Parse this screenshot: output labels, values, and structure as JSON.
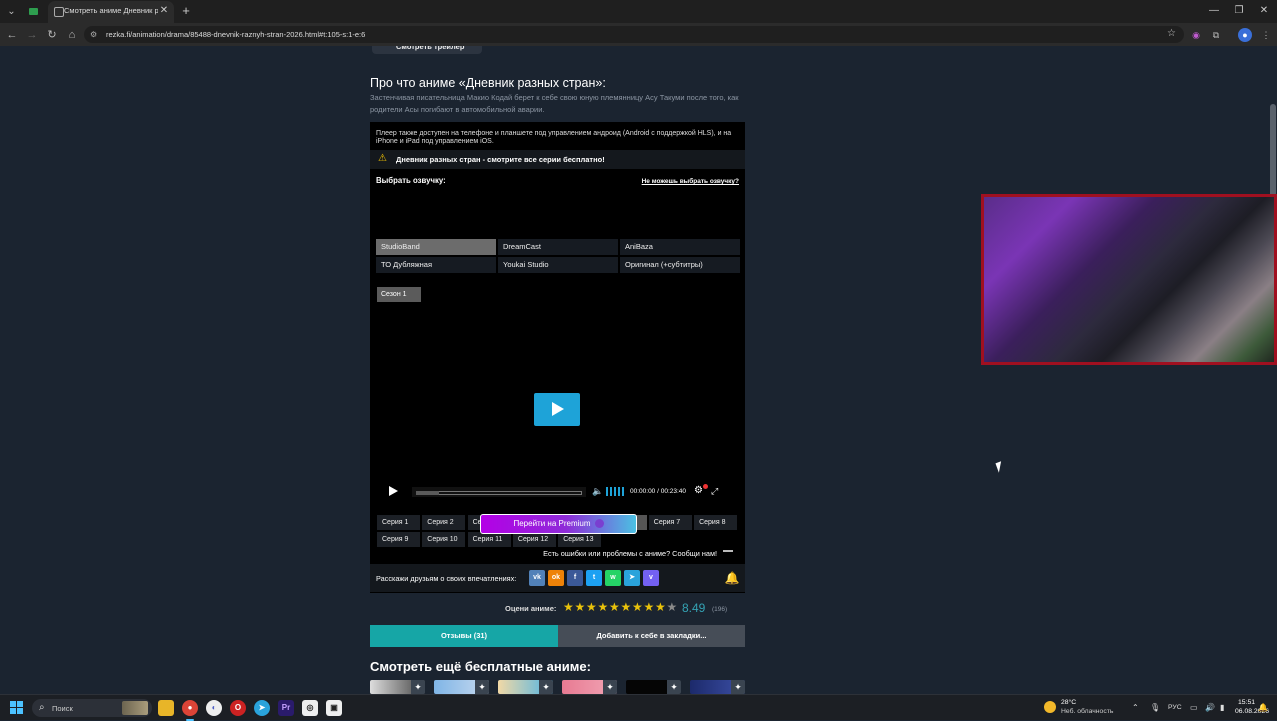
{
  "browser": {
    "tab_title": "Смотреть аниме Дневник раз",
    "url": "rezka.fi/animation/drama/85488-dnevnik-raznyh-stran-2026.html#t:105-s:1-e:6",
    "new_tab": "+",
    "close_tab": "✕"
  },
  "page": {
    "trailer_label": "Смотреть трейлер",
    "about_heading": "Про что аниме «Дневник разных стран»:",
    "about_text": "Застенчивая писательница Макио Кодай берет к себе свою юную племянницу Асу Такуми после того, как родители Асы погибают в автомобильной аварии.",
    "player_note": "Плеер также доступен на телефоне и планшете под управлением андроид (Android с поддержкой HLS), и на iPhone и iPad под управлением iOS.",
    "warn_text": "Дневник разных стран - смотрите все серии бесплатно!",
    "voice_label": "Выбрать озвучку:",
    "voice_help": "Не можешь выбрать озвучку?",
    "voices": [
      "StudioBand",
      "DreamCast",
      "AniBaza",
      "ТО Дубляжная",
      "Youkai Studio",
      "Оригинал (+субтитры)"
    ],
    "season": "Сезон 1",
    "time": "00:00:00 / 00:23:40",
    "progress": 0.14,
    "episodes": [
      "Серия 1",
      "Серия 2",
      "Серия 3",
      "Серия 4",
      "Серия 5",
      "Серия 6",
      "Серия 7",
      "Серия 8",
      "Серия 9",
      "Серия 10",
      "Серия 11",
      "Серия 12",
      "Серия 13"
    ],
    "active_episode": "Серия 6",
    "premium": "Перейти на Premium",
    "report": "Есть ошибки или проблемы с аниме? Сообщи нам!",
    "share_label": "Расскажи друзьям о своих впечатлениях:",
    "social": [
      "vk-icon",
      "ok-icon",
      "facebook-icon",
      "twitter-icon",
      "whatsapp-icon",
      "telegram-icon",
      "viber-icon"
    ],
    "rating_label": "Оцени аниме:",
    "rating_value": "8.49",
    "rating_count": "(196)",
    "stars_filled": 9,
    "stars_total": 10,
    "reviews_tab": "Отзывы (31)",
    "bookmark_tab": "Добавить к себе в закладки...",
    "more_heading": "Смотреть ещё бесплатные аниме:"
  },
  "taskbar": {
    "search_placeholder": "Поиск",
    "weather_temp": "28°C",
    "weather_desc": "Неб. облачность",
    "lang": "РУС",
    "time": "15:51",
    "date": "06.08.2026"
  },
  "colors": {
    "accent": "#1ea3d8",
    "teal": "#16a6a6",
    "star": "#e9c20b",
    "background": "#1b2430"
  }
}
